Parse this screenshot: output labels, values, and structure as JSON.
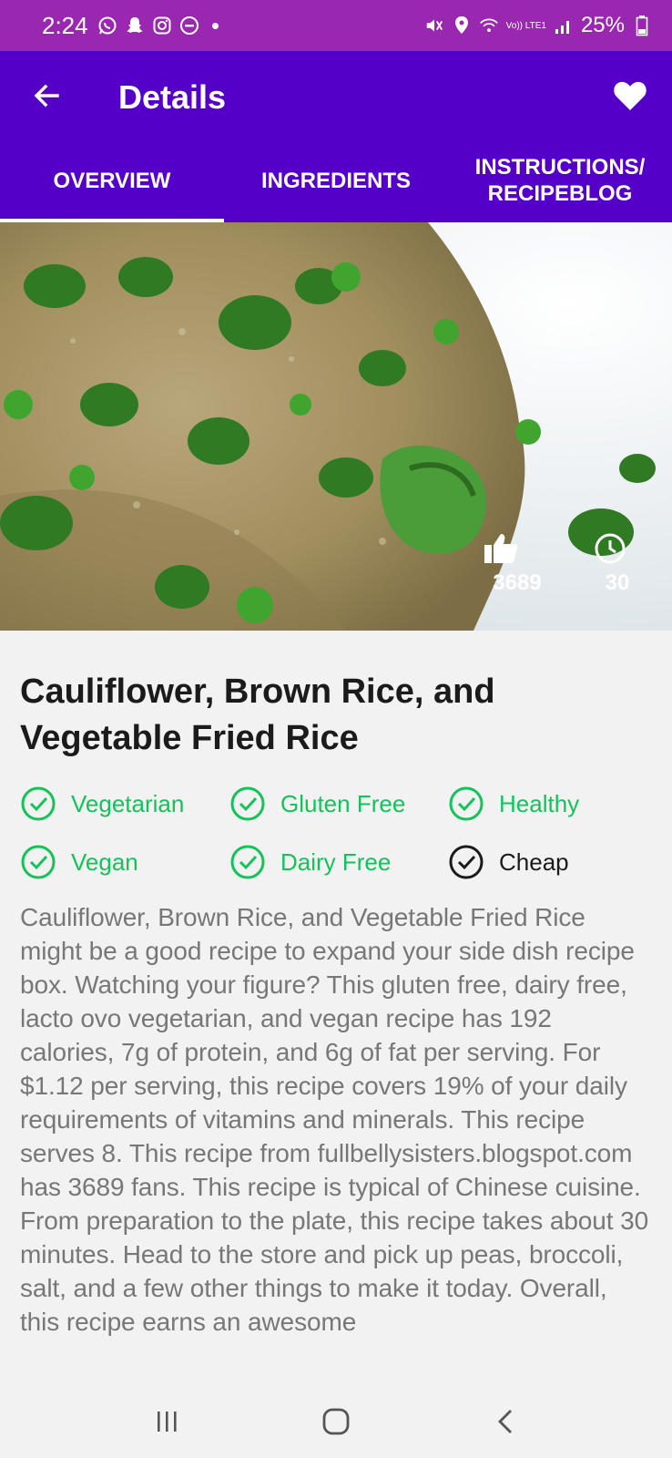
{
  "status_bar": {
    "time": "2:24",
    "battery": "25%",
    "network": "Vo)) LTE1",
    "icons_left": [
      "whatsapp-icon",
      "snapchat-icon",
      "instagram-icon",
      "dnd-icon"
    ],
    "icons_right": [
      "mute-icon",
      "location-icon",
      "wifi-icon",
      "signal-icon",
      "battery-icon"
    ]
  },
  "app_bar": {
    "title": "Details",
    "back_icon": "arrow-back-icon",
    "favorite_icon": "heart-icon"
  },
  "tabs": [
    {
      "label": "OVERVIEW",
      "active": true
    },
    {
      "label": "INGREDIENTS",
      "active": false
    },
    {
      "label": "INSTRUCTIONS/\nRECIPEBLOG",
      "active": false
    }
  ],
  "hero": {
    "likes": "3689",
    "minutes": "30",
    "likes_icon": "thumbs-up-icon",
    "time_icon": "clock-icon"
  },
  "recipe": {
    "title": "Cauliflower, Brown Rice, and Vegetable Fried Rice",
    "tags": [
      {
        "label": "Vegetarian",
        "on": true
      },
      {
        "label": "Gluten Free",
        "on": true
      },
      {
        "label": "Healthy",
        "on": true
      },
      {
        "label": "Vegan",
        "on": true
      },
      {
        "label": "Dairy Free",
        "on": true
      },
      {
        "label": "Cheap",
        "on": false
      }
    ],
    "description": "Cauliflower, Brown Rice, and Vegetable Fried Rice might be a good recipe to expand your side dish recipe box. Watching your figure? This gluten free, dairy free, lacto ovo vegetarian, and vegan recipe has 192 calories, 7g of protein, and 6g of fat per serving. For $1.12 per serving, this recipe covers 19% of your daily requirements of vitamins and minerals. This recipe serves 8. This recipe from fullbellysisters.blogspot.com has 3689 fans. This recipe is typical of Chinese cuisine. From preparation to the plate, this recipe takes about 30 minutes. Head to the store and pick up peas, broccoli, salt, and a few other things to make it today. Overall, this recipe earns an awesome"
  },
  "colors": {
    "status_bar": "#9a27b0",
    "app_bar": "#5400c8",
    "tag_on": "#14c25a",
    "tag_off": "#1b1b1b",
    "description": "#777777"
  },
  "nav_bar": {
    "recent_icon": "recent-apps-icon",
    "home_icon": "home-icon",
    "back_icon": "nav-back-icon"
  }
}
